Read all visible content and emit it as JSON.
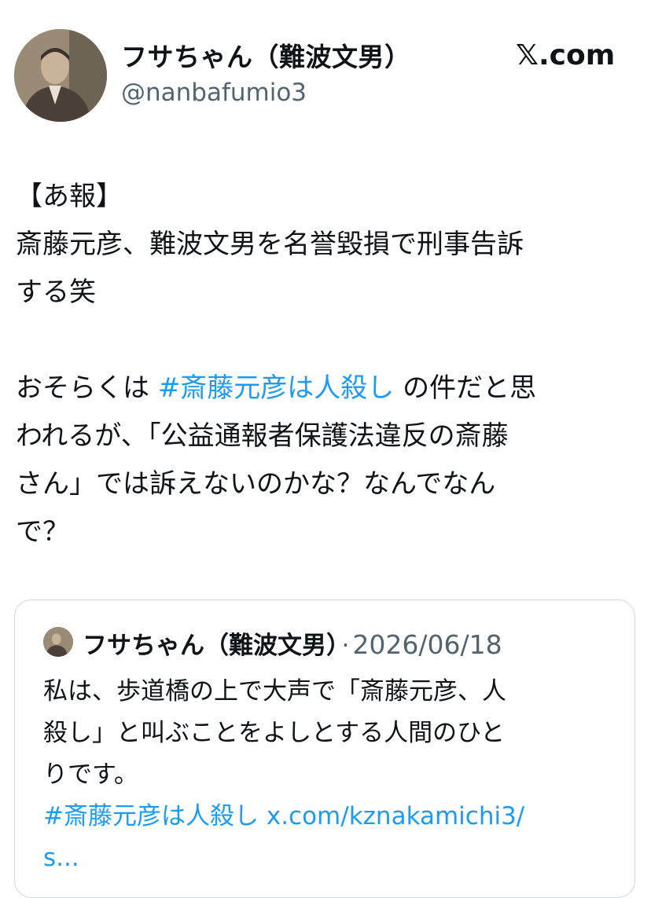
{
  "author": {
    "display_name": "フサちゃん（難波文男）",
    "handle": "@nanbafumio3",
    "avatar_icon": "profile-photo"
  },
  "brand": "𝕏.com",
  "tweet": {
    "lines": [
      "【あ報】",
      "斎藤元彦、難波文男を名誉毀損で刑事告訴",
      "する笑",
      "",
      "おそらくは ",
      "#斎藤元彦は人殺し",
      " の件だと思",
      "われるが、「公益通報者保護法違反の斎藤",
      "さん」では訴えないのかな？なんでなん",
      "で？"
    ]
  },
  "quote": {
    "display_name": "フサちゃん（難波文男）",
    "separator": "·",
    "date": "2026/06/18",
    "lines": [
      "私は、歩道橋の上で大声で「斎藤元彦、人",
      "殺し」と叫ぶことをよしとする人間のひと",
      "りです。"
    ],
    "hashtag": "#斎藤元彦は人殺し",
    "link": "x.com/kznakamichi3/",
    "link_tail": "s..."
  },
  "colors": {
    "link": "#1d9bf0",
    "secondary_text": "#536471",
    "border": "#cfd9de"
  }
}
